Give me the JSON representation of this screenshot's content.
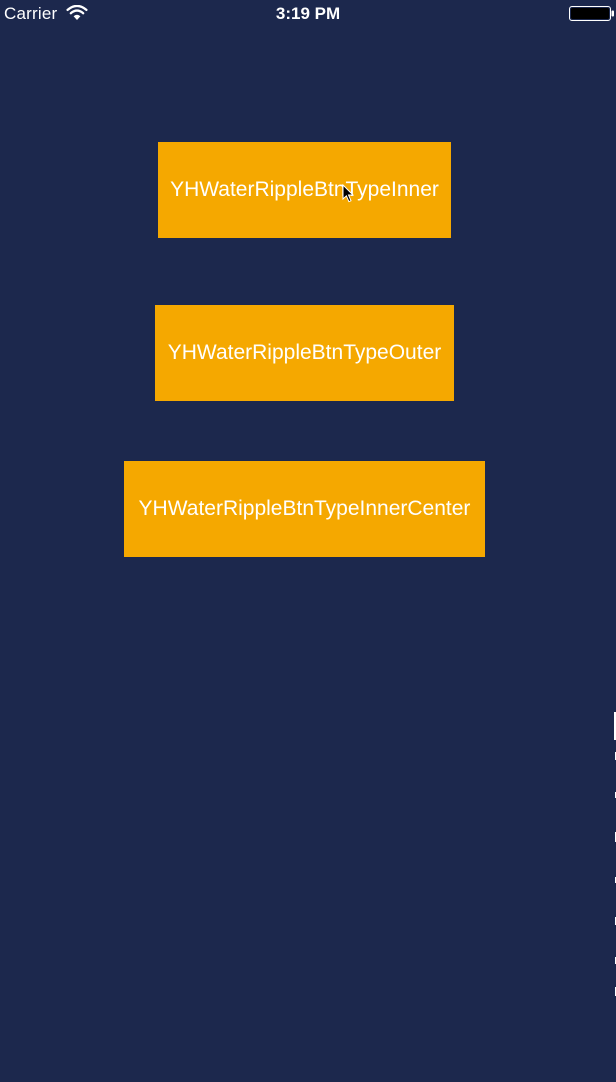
{
  "status_bar": {
    "carrier": "Carrier",
    "time": "3:19 PM"
  },
  "buttons": [
    {
      "label": "YHWaterRippleBtnTypeInner"
    },
    {
      "label": "YHWaterRippleBtnTypeOuter"
    },
    {
      "label": "YHWaterRippleBtnTypeInnerCenter"
    }
  ],
  "colors": {
    "background": "#1c284d",
    "button": "#f5a800",
    "text": "#ffffff"
  },
  "icons": [
    "wifi-icon",
    "battery-icon",
    "cursor-icon"
  ]
}
